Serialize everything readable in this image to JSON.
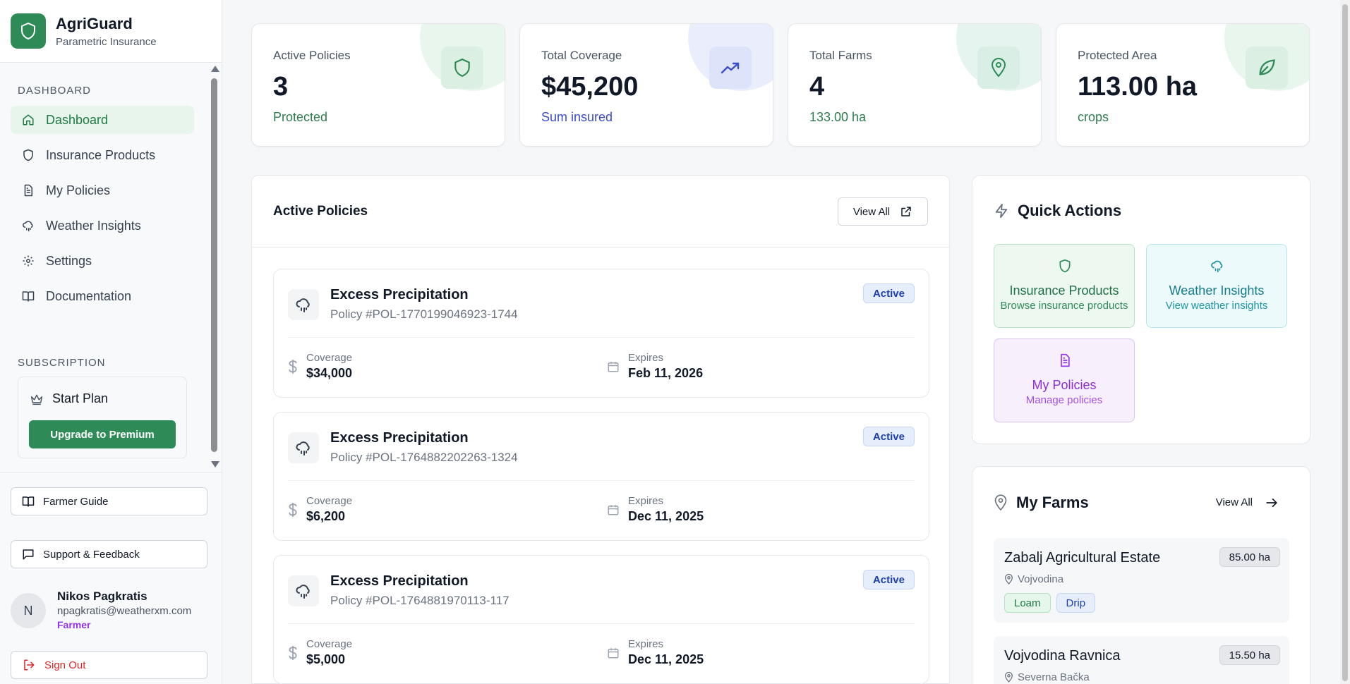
{
  "brand": {
    "name": "AgriGuard",
    "subtitle": "Parametric Insurance"
  },
  "sidebar": {
    "dashboard_section": "DASHBOARD",
    "items": [
      {
        "label": "Dashboard",
        "icon": "home-icon",
        "active": true
      },
      {
        "label": "Insurance Products",
        "icon": "shield-icon"
      },
      {
        "label": "My Policies",
        "icon": "document-icon"
      },
      {
        "label": "Weather Insights",
        "icon": "cloud-rain-icon"
      },
      {
        "label": "Settings",
        "icon": "gear-icon"
      },
      {
        "label": "Documentation",
        "icon": "book-icon"
      }
    ],
    "subscription_section": "SUBSCRIPTION",
    "plan_name": "Start Plan",
    "upgrade_label": "Upgrade to Premium",
    "farmer_guide_label": "Farmer Guide",
    "support_label": "Support & Feedback",
    "user": {
      "initial": "N",
      "name": "Nikos Pagkratis",
      "email": "npagkratis@weatherxm.com",
      "role": "Farmer"
    },
    "sign_out_label": "Sign Out"
  },
  "stats": [
    {
      "label": "Active Policies",
      "value": "3",
      "sub": "Protected",
      "icon": "shield-icon",
      "accent": "#2e8b57"
    },
    {
      "label": "Total Coverage",
      "value": "$45,200",
      "sub": "Sum insured",
      "icon": "trending-up-icon",
      "accent": "#3b4cca"
    },
    {
      "label": "Total Farms",
      "value": "4",
      "sub": "133.00 ha",
      "icon": "map-pin-icon",
      "accent": "#2e8b57"
    },
    {
      "label": "Protected Area",
      "value": "113.00 ha",
      "sub": "crops",
      "icon": "leaf-icon",
      "accent": "#2e8b57"
    }
  ],
  "policies": {
    "title": "Active Policies",
    "view_all_label": "View All",
    "items": [
      {
        "name": "Excess Precipitation",
        "id": "Policy #POL-1770199046923-1744",
        "status": "Active",
        "coverage_label": "Coverage",
        "coverage": "$34,000",
        "expires_label": "Expires",
        "expires": "Feb 11, 2026"
      },
      {
        "name": "Excess Precipitation",
        "id": "Policy #POL-1764882202263-1324",
        "status": "Active",
        "coverage_label": "Coverage",
        "coverage": "$6,200",
        "expires_label": "Expires",
        "expires": "Dec 11, 2025"
      },
      {
        "name": "Excess Precipitation",
        "id": "Policy #POL-1764881970113-117",
        "status": "Active",
        "coverage_label": "Coverage",
        "coverage": "$5,000",
        "expires_label": "Expires",
        "expires": "Dec 11, 2025"
      }
    ]
  },
  "quick_actions": {
    "title": "Quick Actions",
    "tiles": [
      {
        "title": "Insurance Products",
        "subtitle": "Browse insurance products",
        "icon": "shield-icon"
      },
      {
        "title": "Weather Insights",
        "subtitle": "View weather insights",
        "icon": "cloud-rain-icon"
      },
      {
        "title": "My Policies",
        "subtitle": "Manage policies",
        "icon": "document-icon"
      }
    ]
  },
  "farms": {
    "title": "My Farms",
    "view_all_label": "View All",
    "items": [
      {
        "name": "Zabalj Agricultural Estate",
        "location": "Vojvodina",
        "area": "85.00 ha",
        "tags": [
          "Loam",
          "Drip"
        ]
      },
      {
        "name": "Vojvodina Ravnica",
        "location": "Severna Bačka",
        "area": "15.50 ha",
        "tags": []
      }
    ]
  }
}
